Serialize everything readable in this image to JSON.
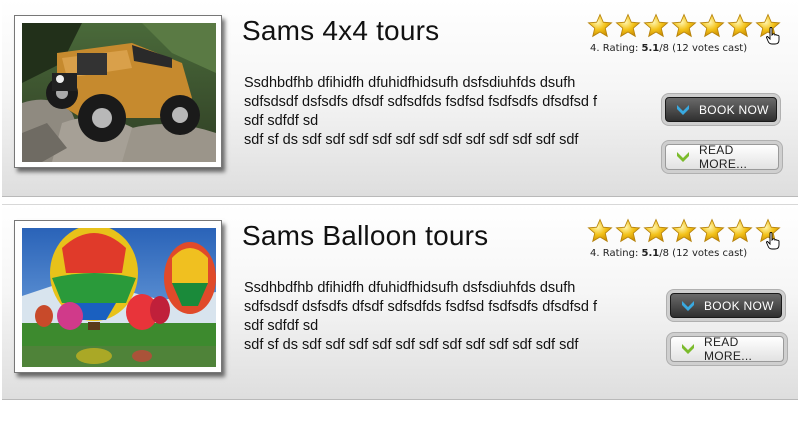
{
  "tours": [
    {
      "title": "Sams 4x4 tours",
      "description_lines": [
        "Ssdhbdfhb  dfihidfh dfuhidfhidsufh dsfsdiuhfds  dsufh",
        "sdfsdsdf dsfsdfs dfsdf sdfsdfds fsdfsd fsdfsdfs dfsdfsd f",
        "sdf sdfdf sd",
        "sdf sf ds sdf sdf sdf sdf sdf sdf sdf sdf sdf sdf sdf sdf"
      ],
      "rating_prefix": "4. Rating:",
      "rating_value": "5.1",
      "rating_max": "/8",
      "votes": "(12 votes cast)",
      "book_label": "BOOK NOW",
      "more_label": "READ MORE...",
      "image_icon": "jeep-photo"
    },
    {
      "title": "Sams Balloon tours",
      "description_lines": [
        "Ssdhbdfhb  dfihidfh dfuhidfhidsufh dsfsdiuhfds  dsufh",
        "sdfsdsdf dsfsdfs dfsdf sdfsdfds fsdfsd fsdfsdfs dfsdfsd f",
        "sdf sdfdf sd",
        "sdf sf ds sdf sdf sdf sdf sdf sdf sdf sdf sdf sdf sdf sdf"
      ],
      "rating_prefix": "4. Rating:",
      "rating_value": "5.1",
      "rating_max": "/8",
      "votes": "(12 votes cast)",
      "book_label": "BOOK NOW",
      "more_label": "READ MORE...",
      "image_icon": "hot-air-balloons-photo"
    }
  ],
  "stars_shown": 7,
  "colors": {
    "star_fill": "#f3c21a",
    "book_button": "#3a3a3a",
    "chevron_blue": "#39a9e0",
    "chevron_green": "#7bbb2c"
  }
}
